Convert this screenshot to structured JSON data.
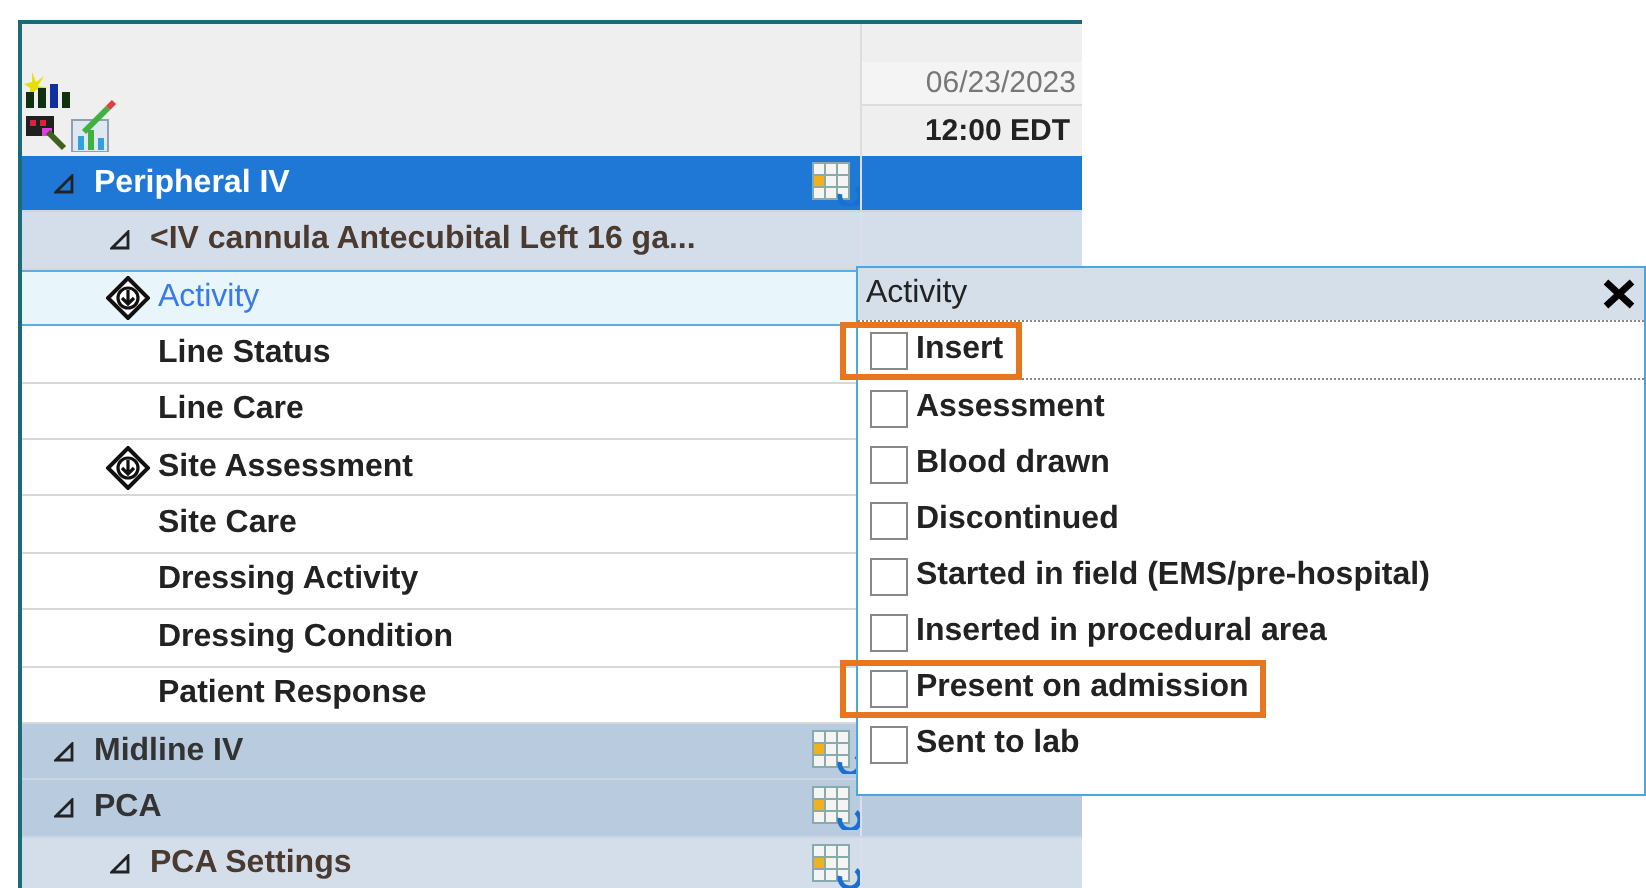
{
  "header": {
    "date": "06/23/2023",
    "time": "12:00 EDT"
  },
  "rows": [
    {
      "kind": "group",
      "label": "Peripheral IV",
      "selected": true,
      "expanded": true
    },
    {
      "kind": "subgroup",
      "label": "<IV cannula Antecubital Left 16 ga...",
      "selected": false,
      "expanded": true
    },
    {
      "kind": "field",
      "label": "Activity",
      "selected": true,
      "marker": true
    },
    {
      "kind": "field",
      "label": "Line Status",
      "selected": false,
      "marker": false
    },
    {
      "kind": "field",
      "label": "Line Care",
      "selected": false,
      "marker": false
    },
    {
      "kind": "field",
      "label": "Site Assessment",
      "selected": false,
      "marker": true
    },
    {
      "kind": "field",
      "label": "Site Care",
      "selected": false,
      "marker": false
    },
    {
      "kind": "field",
      "label": "Dressing Activity",
      "selected": false,
      "marker": false
    },
    {
      "kind": "field",
      "label": "Dressing Condition",
      "selected": false,
      "marker": false
    },
    {
      "kind": "field",
      "label": "Patient Response",
      "selected": false,
      "marker": false
    },
    {
      "kind": "group",
      "label": "Midline IV",
      "selected": false,
      "expanded": true
    },
    {
      "kind": "group",
      "label": "PCA",
      "selected": false,
      "expanded": true
    },
    {
      "kind": "subgroup",
      "label": "PCA Settings",
      "selected": false,
      "expanded": true
    }
  ],
  "popup": {
    "title": "Activity",
    "options": [
      {
        "label": "Insert",
        "checked": false,
        "highlighted": true
      },
      {
        "label": "Assessment",
        "checked": false,
        "highlighted": false
      },
      {
        "label": "Blood drawn",
        "checked": false,
        "highlighted": false
      },
      {
        "label": "Discontinued",
        "checked": false,
        "highlighted": false
      },
      {
        "label": "Started in field (EMS/pre-hospital)",
        "checked": false,
        "highlighted": false
      },
      {
        "label": "Inserted in procedural area",
        "checked": false,
        "highlighted": false
      },
      {
        "label": "Present on admission",
        "checked": false,
        "highlighted": true
      },
      {
        "label": "Sent to lab",
        "checked": false,
        "highlighted": false
      }
    ]
  }
}
